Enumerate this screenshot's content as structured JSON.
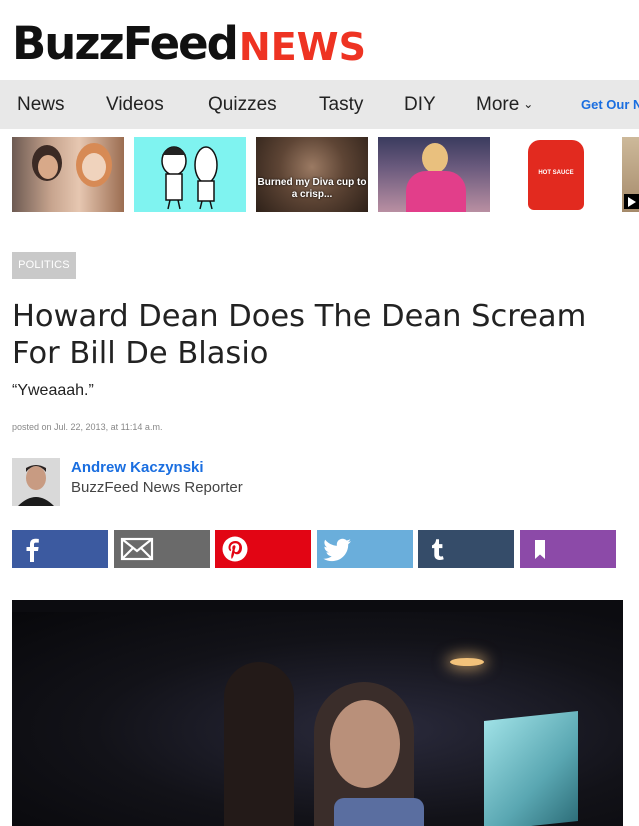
{
  "header": {
    "logo_main": "BuzzFeed",
    "logo_section": "NEWS"
  },
  "nav": {
    "items": [
      "News",
      "Videos",
      "Quizzes",
      "Tasty",
      "DIY",
      "More"
    ],
    "cta": "Get Our N"
  },
  "thumbnails": {
    "t3_caption": "Burned my Diva cup to a crisp...",
    "t5_label": "HOT SAUCE"
  },
  "article": {
    "category": "POLITICS",
    "title": "Howard Dean Does The Dean Scream For Bill De Blasio",
    "dek": "“Yweaaah.”",
    "posted": "posted on Jul. 22, 2013, at 11:14 a.m."
  },
  "author": {
    "name": "Andrew Kaczynski",
    "role": "BuzzFeed News Reporter"
  },
  "share": {
    "colors": {
      "facebook": "#3c5aa0",
      "email": "#6a6a6a",
      "pinterest": "#e20514",
      "twitter": "#6aaedb",
      "tumblr": "#354c69",
      "bookmark": "#8c4aa8"
    },
    "icons": [
      "facebook-icon",
      "email-icon",
      "pinterest-icon",
      "twitter-icon",
      "tumblr-icon",
      "bookmark-icon"
    ]
  },
  "colors": {
    "brand_red": "#ee3322",
    "link_blue": "#1a6ee0",
    "nav_bg": "#e8e8e8"
  }
}
